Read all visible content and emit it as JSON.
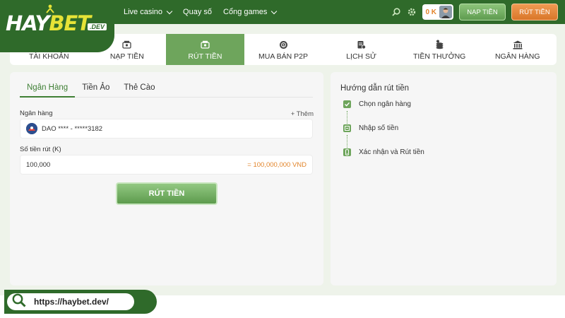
{
  "brand": {
    "logo_main_prefix": "HAY",
    "logo_main_suffix": "BET",
    "logo_tld": ".DEV"
  },
  "nav": {
    "items": [
      {
        "label": "Live casino",
        "has_dropdown": true
      },
      {
        "label": "Quay số",
        "has_dropdown": false
      },
      {
        "label": "Cổng games",
        "has_dropdown": true
      }
    ]
  },
  "header": {
    "balance": "0 K",
    "deposit_label": "NẠP TIỀN",
    "withdraw_label": "RÚT TIỀN"
  },
  "tabs": [
    {
      "label": "TÀI KHOẢN",
      "icon": "user-icon",
      "active": false
    },
    {
      "label": "NẠP TIỀN",
      "icon": "wallet-icon",
      "active": false
    },
    {
      "label": "RÚT TIỀN",
      "icon": "cash-out-icon",
      "active": true
    },
    {
      "label": "MUA BÁN P2P",
      "icon": "coin-exchange-icon",
      "active": false
    },
    {
      "label": "LỊCH SỬ",
      "icon": "history-icon",
      "active": false
    },
    {
      "label": "TIỀN THƯỞNG",
      "icon": "coins-icon",
      "active": false
    },
    {
      "label": "NGÂN HÀNG",
      "icon": "bank-icon",
      "active": false
    }
  ],
  "withdraw_form": {
    "subtabs": [
      {
        "label": "Ngân Hàng",
        "active": true
      },
      {
        "label": "Tiền Ảo",
        "active": false
      },
      {
        "label": "Thẻ Cào",
        "active": false
      }
    ],
    "bank_label": "Ngân hàng",
    "add_label": "Thêm",
    "bank_value": "DAO **** - *****3182",
    "amount_label": "Số tiền rút (K)",
    "amount_value": "100,000",
    "amount_hint": "= 100,000,000 VND",
    "submit_label": "RÚT TIỀN"
  },
  "guide": {
    "title": "Hướng dẫn rút tiền",
    "steps": [
      {
        "label": "Chọn ngân hàng",
        "icon": "check-icon"
      },
      {
        "label": "Nhập số tiền",
        "icon": "edit-icon"
      },
      {
        "label": "Xác nhận và Rút tiền",
        "icon": "phone-icon"
      }
    ]
  },
  "footer": {
    "url": "https://haybet.dev/"
  },
  "colors": {
    "brand_green": "#2f6a2a",
    "active_green": "#6ea55c",
    "orange": "#e2852b"
  }
}
